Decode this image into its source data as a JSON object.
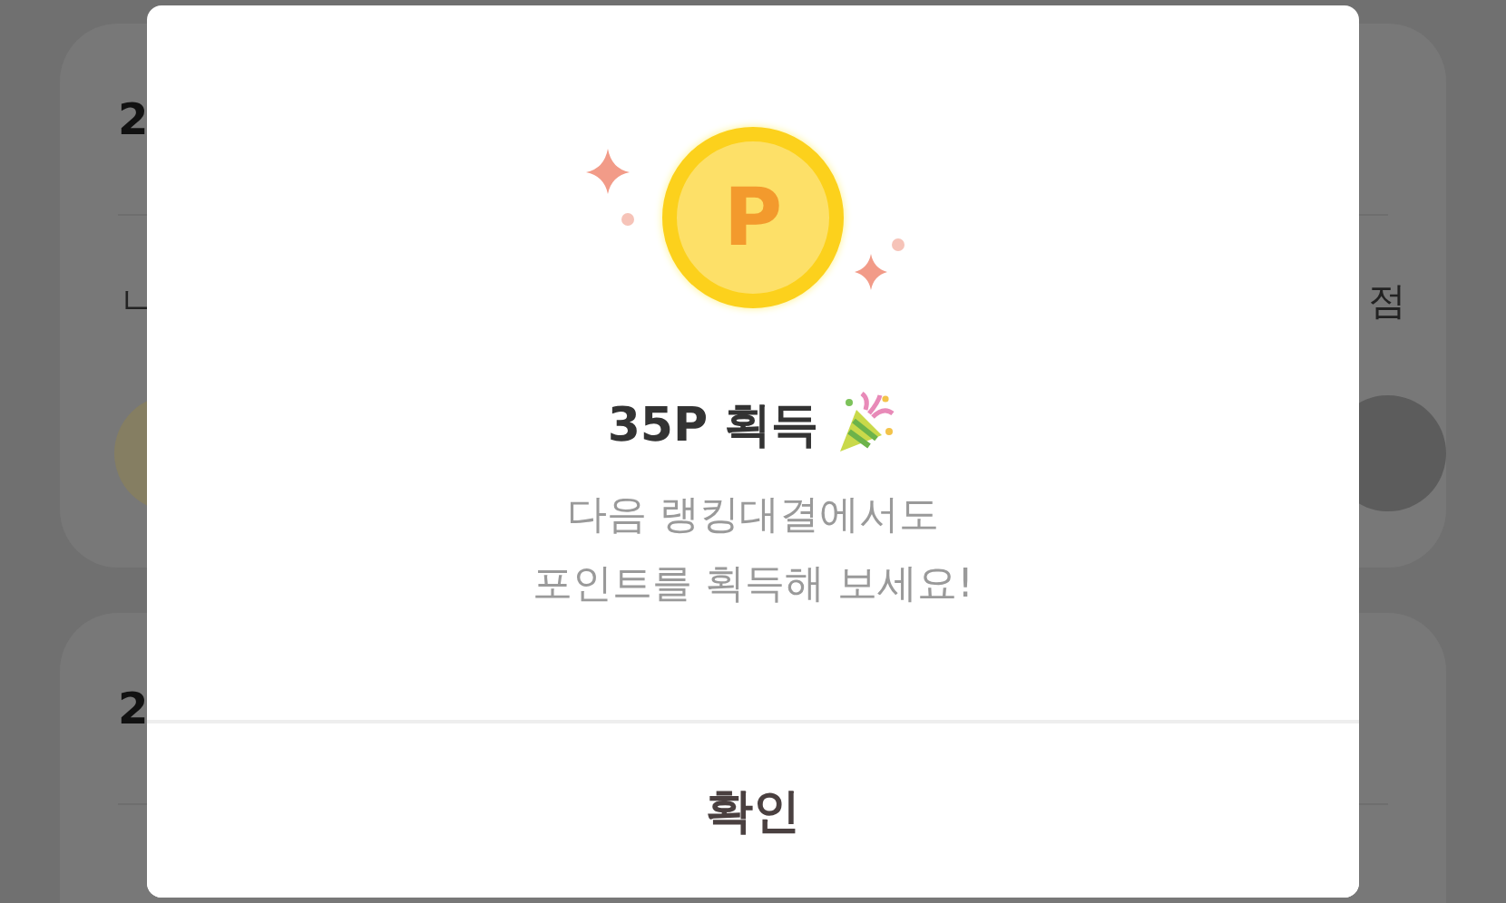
{
  "background_cards": [
    {
      "heading": "2",
      "left_text": "ㄴ",
      "right_text": "점",
      "avatar": true
    },
    {
      "heading": "2"
    }
  ],
  "dialog": {
    "coin_label": "P",
    "title": "35P 획득",
    "message": [
      "다음 랭킹대결에서도",
      "포인트를 획득해 보세요!"
    ],
    "confirm_button": "확인"
  }
}
